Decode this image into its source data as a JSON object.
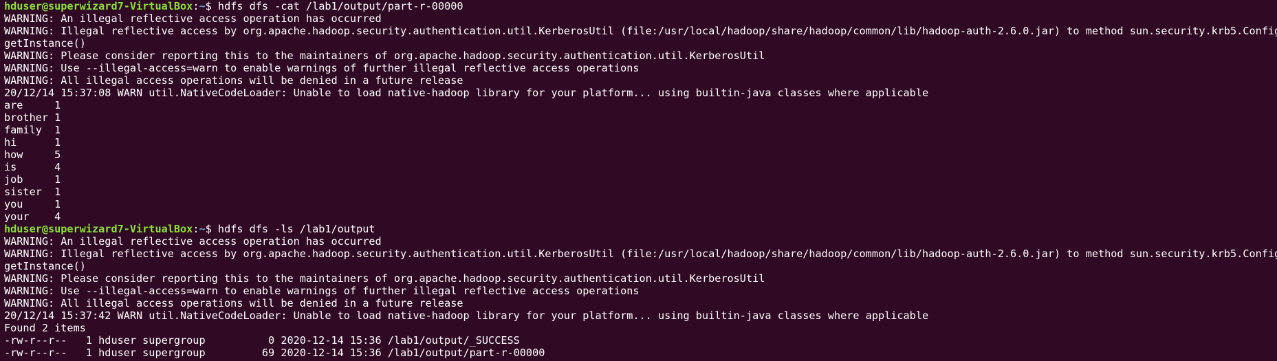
{
  "colors": {
    "background": "#300a24",
    "foreground": "#ffffff",
    "prompt_user": "#8ae234",
    "prompt_path": "#729fcf"
  },
  "prompt": {
    "user_host": "hduser@superwizard7-VirtualBox",
    "separator": ":",
    "path": "~",
    "symbol": "$ "
  },
  "lines": [
    {
      "type": "prompt",
      "command": "hdfs dfs -cat /lab1/output/part-r-00000"
    },
    {
      "type": "output",
      "text": "WARNING: An illegal reflective access operation has occurred"
    },
    {
      "type": "output",
      "text": "WARNING: Illegal reflective access by org.apache.hadoop.security.authentication.util.KerberosUtil (file:/usr/local/hadoop/share/hadoop/common/lib/hadoop-auth-2.6.0.jar) to method sun.security.krb5.Config."
    },
    {
      "type": "output",
      "text": "getInstance()"
    },
    {
      "type": "output",
      "text": "WARNING: Please consider reporting this to the maintainers of org.apache.hadoop.security.authentication.util.KerberosUtil"
    },
    {
      "type": "output",
      "text": "WARNING: Use --illegal-access=warn to enable warnings of further illegal reflective access operations"
    },
    {
      "type": "output",
      "text": "WARNING: All illegal access operations will be denied in a future release"
    },
    {
      "type": "output",
      "text": "20/12/14 15:37:08 WARN util.NativeCodeLoader: Unable to load native-hadoop library for your platform... using builtin-java classes where applicable"
    },
    {
      "type": "output",
      "text": "are     1"
    },
    {
      "type": "output",
      "text": "brother 1"
    },
    {
      "type": "output",
      "text": "family  1"
    },
    {
      "type": "output",
      "text": "hi      1"
    },
    {
      "type": "output",
      "text": "how     5"
    },
    {
      "type": "output",
      "text": "is      4"
    },
    {
      "type": "output",
      "text": "job     1"
    },
    {
      "type": "output",
      "text": "sister  1"
    },
    {
      "type": "output",
      "text": "you     1"
    },
    {
      "type": "output",
      "text": "your    4"
    },
    {
      "type": "prompt",
      "command": "hdfs dfs -ls /lab1/output"
    },
    {
      "type": "output",
      "text": "WARNING: An illegal reflective access operation has occurred"
    },
    {
      "type": "output",
      "text": "WARNING: Illegal reflective access by org.apache.hadoop.security.authentication.util.KerberosUtil (file:/usr/local/hadoop/share/hadoop/common/lib/hadoop-auth-2.6.0.jar) to method sun.security.krb5.Config."
    },
    {
      "type": "output",
      "text": "getInstance()"
    },
    {
      "type": "output",
      "text": "WARNING: Please consider reporting this to the maintainers of org.apache.hadoop.security.authentication.util.KerberosUtil"
    },
    {
      "type": "output",
      "text": "WARNING: Use --illegal-access=warn to enable warnings of further illegal reflective access operations"
    },
    {
      "type": "output",
      "text": "WARNING: All illegal access operations will be denied in a future release"
    },
    {
      "type": "output",
      "text": "20/12/14 15:37:42 WARN util.NativeCodeLoader: Unable to load native-hadoop library for your platform... using builtin-java classes where applicable"
    },
    {
      "type": "output",
      "text": "Found 2 items"
    },
    {
      "type": "output",
      "text": "-rw-r--r--   1 hduser supergroup          0 2020-12-14 15:36 /lab1/output/_SUCCESS"
    },
    {
      "type": "output",
      "text": "-rw-r--r--   1 hduser supergroup         69 2020-12-14 15:36 /lab1/output/part-r-00000"
    }
  ]
}
